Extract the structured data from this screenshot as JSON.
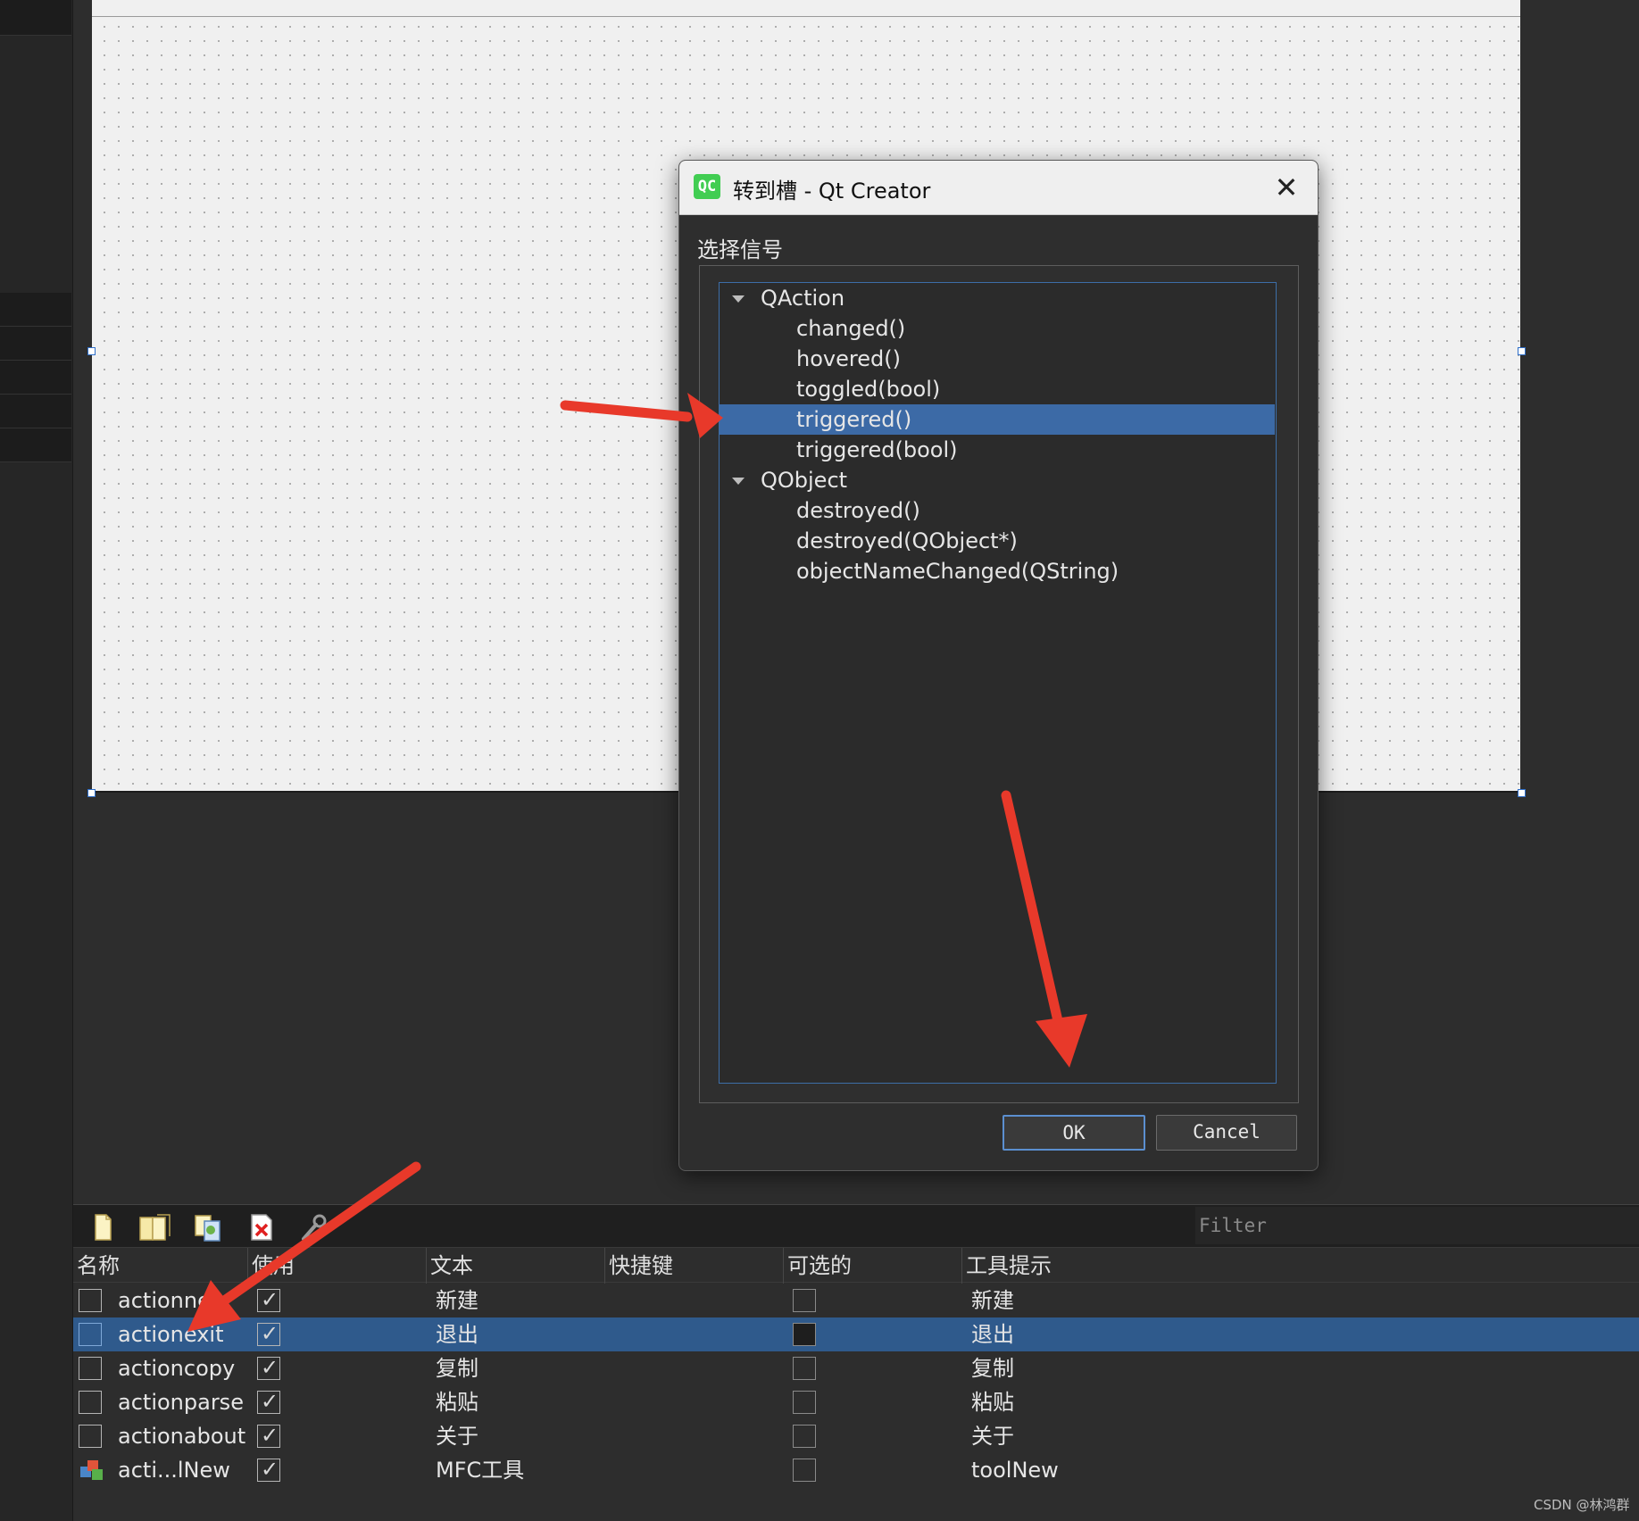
{
  "dialog": {
    "title": "转到槽 - Qt Creator",
    "icon_text": "QC",
    "close_icon": "close-icon",
    "section_label": "选择信号",
    "tree": [
      {
        "label": "QAction",
        "type": "group"
      },
      {
        "label": "changed()",
        "type": "item"
      },
      {
        "label": "hovered()",
        "type": "item"
      },
      {
        "label": "toggled(bool)",
        "type": "item"
      },
      {
        "label": "triggered()",
        "type": "item",
        "selected": true
      },
      {
        "label": "triggered(bool)",
        "type": "item"
      },
      {
        "label": "QObject",
        "type": "group"
      },
      {
        "label": "destroyed()",
        "type": "item"
      },
      {
        "label": "destroyed(QObject*)",
        "type": "item"
      },
      {
        "label": "objectNameChanged(QString)",
        "type": "item"
      }
    ],
    "ok_label": "OK",
    "cancel_label": "Cancel"
  },
  "action_editor": {
    "filter_placeholder": "Filter",
    "toolbar_icons": [
      "new-action-icon",
      "new-action-folder-icon",
      "copy-action-icon",
      "delete-action-icon",
      "configure-icon"
    ],
    "columns": [
      "名称",
      "使用",
      "文本",
      "快捷键",
      "可选的",
      "工具提示"
    ],
    "rows": [
      {
        "name": "actionnew",
        "used": true,
        "text": "新建",
        "shortcut": "",
        "checkable": false,
        "tooltip": "新建"
      },
      {
        "name": "actionexit",
        "used": true,
        "text": "退出",
        "shortcut": "",
        "checkable": false,
        "tooltip": "退出",
        "selected": true
      },
      {
        "name": "actioncopy",
        "used": true,
        "text": "复制",
        "shortcut": "",
        "checkable": false,
        "tooltip": "复制"
      },
      {
        "name": "actionparse",
        "used": true,
        "text": "粘贴",
        "shortcut": "",
        "checkable": false,
        "tooltip": "粘贴"
      },
      {
        "name": "actionabout",
        "used": true,
        "text": "关于",
        "shortcut": "",
        "checkable": false,
        "tooltip": "关于"
      },
      {
        "name": "acti...lNew",
        "used": true,
        "text": "MFC工具",
        "shortcut": "",
        "checkable": false,
        "tooltip": "toolNew"
      }
    ]
  },
  "watermark": "CSDN @林鸿群",
  "colors": {
    "selection": "#3c6aa6",
    "annotation_arrow": "#e8392a",
    "qt_green": "#41cd52"
  }
}
